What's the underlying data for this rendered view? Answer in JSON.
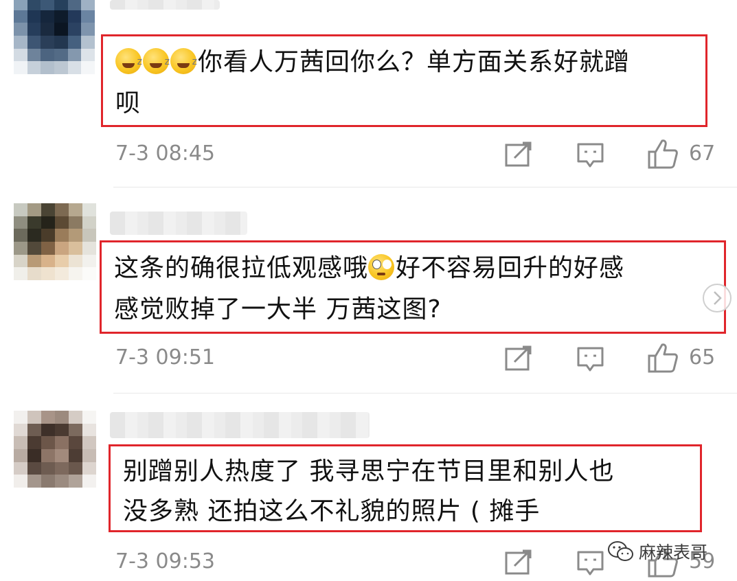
{
  "comments": [
    {
      "text_line1": "你看人万茜回你么？单方面关系好就蹭",
      "text_line2": "呗",
      "emojis": [
        "yawn-emoji",
        "yawn-emoji",
        "yawn-emoji"
      ],
      "timestamp": "7-3 08:45",
      "likes": "67"
    },
    {
      "text_line1a": "这条的确很拉低观感哦",
      "text_line1b": "好不容易回升的好感",
      "text_line2": "感觉败掉了一大半 万茜这图?",
      "emojis": [
        "eye-roll-emoji"
      ],
      "timestamp": "7-3 09:51",
      "likes": "65"
    },
    {
      "text_line1": "别蹭别人热度了  我寻思宁在节目里和别人也",
      "text_line2": "没多熟  还拍这么不礼貌的照片 ( 摊手",
      "timestamp": "7-3 09:53",
      "likes": "59"
    }
  ],
  "watermark": {
    "label": "麻辣表哥",
    "icon": "wechat-icon"
  },
  "colors": {
    "highlight_border": "#e0252b",
    "meta_text": "#8a8a8a"
  }
}
